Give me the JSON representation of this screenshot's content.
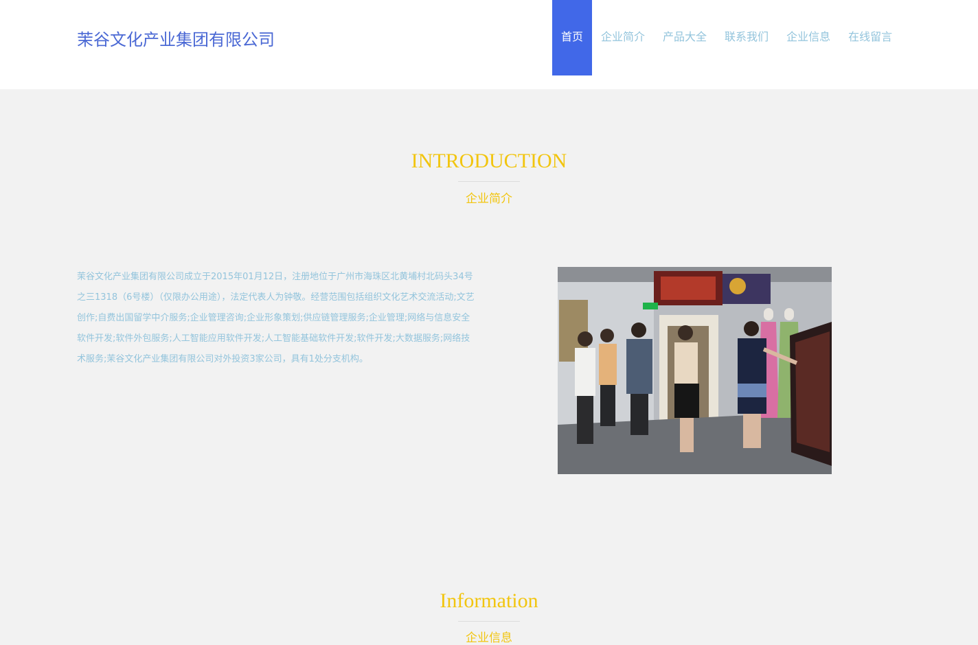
{
  "header": {
    "logo": "茉谷文化产业集团有限公司",
    "nav": [
      {
        "label": "首页",
        "active": true
      },
      {
        "label": "企业简介",
        "active": false
      },
      {
        "label": "产品大全",
        "active": false
      },
      {
        "label": "联系我们",
        "active": false
      },
      {
        "label": "企业信息",
        "active": false
      },
      {
        "label": "在线留言",
        "active": false
      }
    ]
  },
  "intro": {
    "title": "INTRODUCTION",
    "subtitle": "企业简介",
    "text": "茉谷文化产业集团有限公司成立于2015年01月12日，注册地位于广州市海珠区北黄埔村北码头34号之三1318（6号楼）（仅限办公用途），法定代表人为钟敬。经营范围包括组织文化艺术交流活动;文艺创作;自费出国留学中介服务;企业管理咨询;企业形象策划;供应链管理服务;企业管理;网络与信息安全软件开发;软件外包服务;人工智能应用软件开发;人工智能基础软件开发;软件开发;大数据服务;网络技术服务;茉谷文化产业集团有限公司对外投资3家公司，具有1处分支机构。"
  },
  "info": {
    "title": "Information",
    "subtitle": "企业信息"
  },
  "colors": {
    "accent": "#4168e8",
    "logo": "#4a68d4",
    "nav_text": "#93c4dc",
    "heading": "#f2c50f",
    "background": "#f2f2f2"
  }
}
